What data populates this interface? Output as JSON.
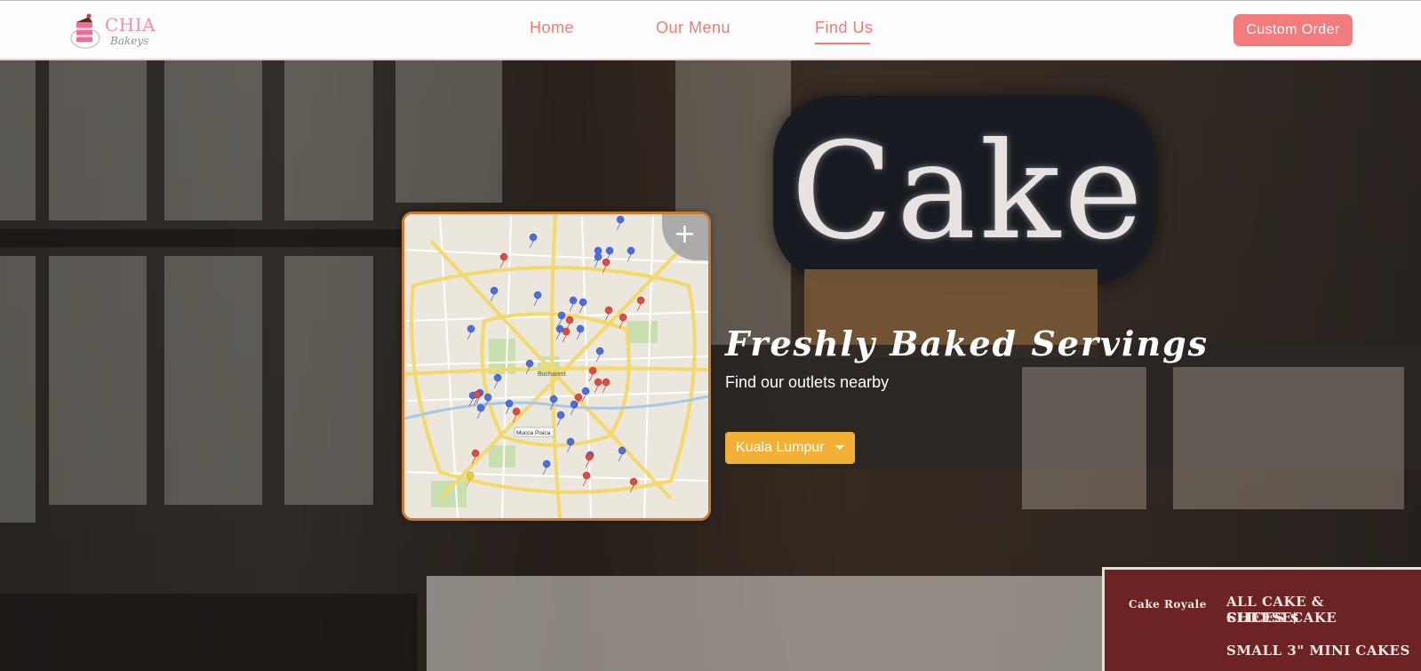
{
  "brand": {
    "name": "CHIA",
    "tagline": "Bakeys"
  },
  "nav": {
    "links": [
      {
        "label": "Home"
      },
      {
        "label": "Our Menu"
      },
      {
        "label": "Find Us",
        "active": true
      }
    ],
    "cta_label": "Custom Order"
  },
  "hero": {
    "background_sign": "Cake",
    "title": "Freshly Baked Servings",
    "subtitle": "Find our outlets nearby",
    "city_selector": {
      "selected": "Kuala Lumpur"
    },
    "stall_sign": {
      "brand": "Cake Royale",
      "line1": "ALL CAKE & CHEESECAKE",
      "line2": "SLICES $",
      "line3": "SMALL 3\" MINI CAKES"
    }
  },
  "map": {
    "zoom_symbol": "+",
    "city_label": "Bucharest",
    "place_label": "Mucca Pisica"
  },
  "colors": {
    "accent": "#f07b6a",
    "cta": "#f27c7d",
    "city_button": "#f2b136",
    "map_border": "#c9792f",
    "brand_pink": "#ee8fa4"
  }
}
